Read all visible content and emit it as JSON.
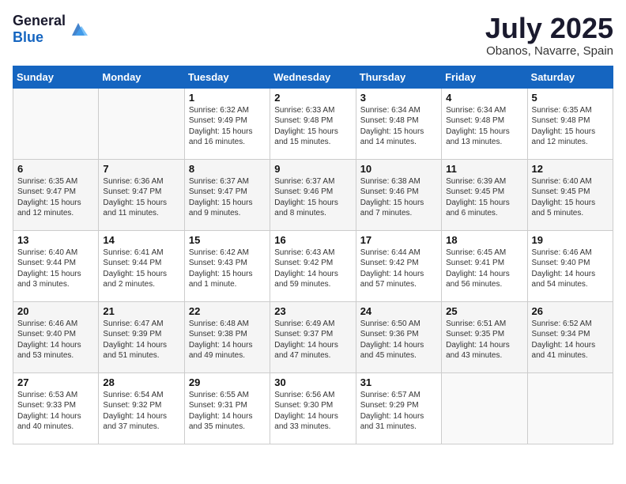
{
  "header": {
    "logo_general": "General",
    "logo_blue": "Blue",
    "month_year": "July 2025",
    "location": "Obanos, Navarre, Spain"
  },
  "weekdays": [
    "Sunday",
    "Monday",
    "Tuesday",
    "Wednesday",
    "Thursday",
    "Friday",
    "Saturday"
  ],
  "weeks": [
    [
      {
        "day": "",
        "info": ""
      },
      {
        "day": "",
        "info": ""
      },
      {
        "day": "1",
        "info": "Sunrise: 6:32 AM\nSunset: 9:49 PM\nDaylight: 15 hours and 16 minutes."
      },
      {
        "day": "2",
        "info": "Sunrise: 6:33 AM\nSunset: 9:48 PM\nDaylight: 15 hours and 15 minutes."
      },
      {
        "day": "3",
        "info": "Sunrise: 6:34 AM\nSunset: 9:48 PM\nDaylight: 15 hours and 14 minutes."
      },
      {
        "day": "4",
        "info": "Sunrise: 6:34 AM\nSunset: 9:48 PM\nDaylight: 15 hours and 13 minutes."
      },
      {
        "day": "5",
        "info": "Sunrise: 6:35 AM\nSunset: 9:48 PM\nDaylight: 15 hours and 12 minutes."
      }
    ],
    [
      {
        "day": "6",
        "info": "Sunrise: 6:35 AM\nSunset: 9:47 PM\nDaylight: 15 hours and 12 minutes."
      },
      {
        "day": "7",
        "info": "Sunrise: 6:36 AM\nSunset: 9:47 PM\nDaylight: 15 hours and 11 minutes."
      },
      {
        "day": "8",
        "info": "Sunrise: 6:37 AM\nSunset: 9:47 PM\nDaylight: 15 hours and 9 minutes."
      },
      {
        "day": "9",
        "info": "Sunrise: 6:37 AM\nSunset: 9:46 PM\nDaylight: 15 hours and 8 minutes."
      },
      {
        "day": "10",
        "info": "Sunrise: 6:38 AM\nSunset: 9:46 PM\nDaylight: 15 hours and 7 minutes."
      },
      {
        "day": "11",
        "info": "Sunrise: 6:39 AM\nSunset: 9:45 PM\nDaylight: 15 hours and 6 minutes."
      },
      {
        "day": "12",
        "info": "Sunrise: 6:40 AM\nSunset: 9:45 PM\nDaylight: 15 hours and 5 minutes."
      }
    ],
    [
      {
        "day": "13",
        "info": "Sunrise: 6:40 AM\nSunset: 9:44 PM\nDaylight: 15 hours and 3 minutes."
      },
      {
        "day": "14",
        "info": "Sunrise: 6:41 AM\nSunset: 9:44 PM\nDaylight: 15 hours and 2 minutes."
      },
      {
        "day": "15",
        "info": "Sunrise: 6:42 AM\nSunset: 9:43 PM\nDaylight: 15 hours and 1 minute."
      },
      {
        "day": "16",
        "info": "Sunrise: 6:43 AM\nSunset: 9:42 PM\nDaylight: 14 hours and 59 minutes."
      },
      {
        "day": "17",
        "info": "Sunrise: 6:44 AM\nSunset: 9:42 PM\nDaylight: 14 hours and 57 minutes."
      },
      {
        "day": "18",
        "info": "Sunrise: 6:45 AM\nSunset: 9:41 PM\nDaylight: 14 hours and 56 minutes."
      },
      {
        "day": "19",
        "info": "Sunrise: 6:46 AM\nSunset: 9:40 PM\nDaylight: 14 hours and 54 minutes."
      }
    ],
    [
      {
        "day": "20",
        "info": "Sunrise: 6:46 AM\nSunset: 9:40 PM\nDaylight: 14 hours and 53 minutes."
      },
      {
        "day": "21",
        "info": "Sunrise: 6:47 AM\nSunset: 9:39 PM\nDaylight: 14 hours and 51 minutes."
      },
      {
        "day": "22",
        "info": "Sunrise: 6:48 AM\nSunset: 9:38 PM\nDaylight: 14 hours and 49 minutes."
      },
      {
        "day": "23",
        "info": "Sunrise: 6:49 AM\nSunset: 9:37 PM\nDaylight: 14 hours and 47 minutes."
      },
      {
        "day": "24",
        "info": "Sunrise: 6:50 AM\nSunset: 9:36 PM\nDaylight: 14 hours and 45 minutes."
      },
      {
        "day": "25",
        "info": "Sunrise: 6:51 AM\nSunset: 9:35 PM\nDaylight: 14 hours and 43 minutes."
      },
      {
        "day": "26",
        "info": "Sunrise: 6:52 AM\nSunset: 9:34 PM\nDaylight: 14 hours and 41 minutes."
      }
    ],
    [
      {
        "day": "27",
        "info": "Sunrise: 6:53 AM\nSunset: 9:33 PM\nDaylight: 14 hours and 40 minutes."
      },
      {
        "day": "28",
        "info": "Sunrise: 6:54 AM\nSunset: 9:32 PM\nDaylight: 14 hours and 37 minutes."
      },
      {
        "day": "29",
        "info": "Sunrise: 6:55 AM\nSunset: 9:31 PM\nDaylight: 14 hours and 35 minutes."
      },
      {
        "day": "30",
        "info": "Sunrise: 6:56 AM\nSunset: 9:30 PM\nDaylight: 14 hours and 33 minutes."
      },
      {
        "day": "31",
        "info": "Sunrise: 6:57 AM\nSunset: 9:29 PM\nDaylight: 14 hours and 31 minutes."
      },
      {
        "day": "",
        "info": ""
      },
      {
        "day": "",
        "info": ""
      }
    ]
  ]
}
